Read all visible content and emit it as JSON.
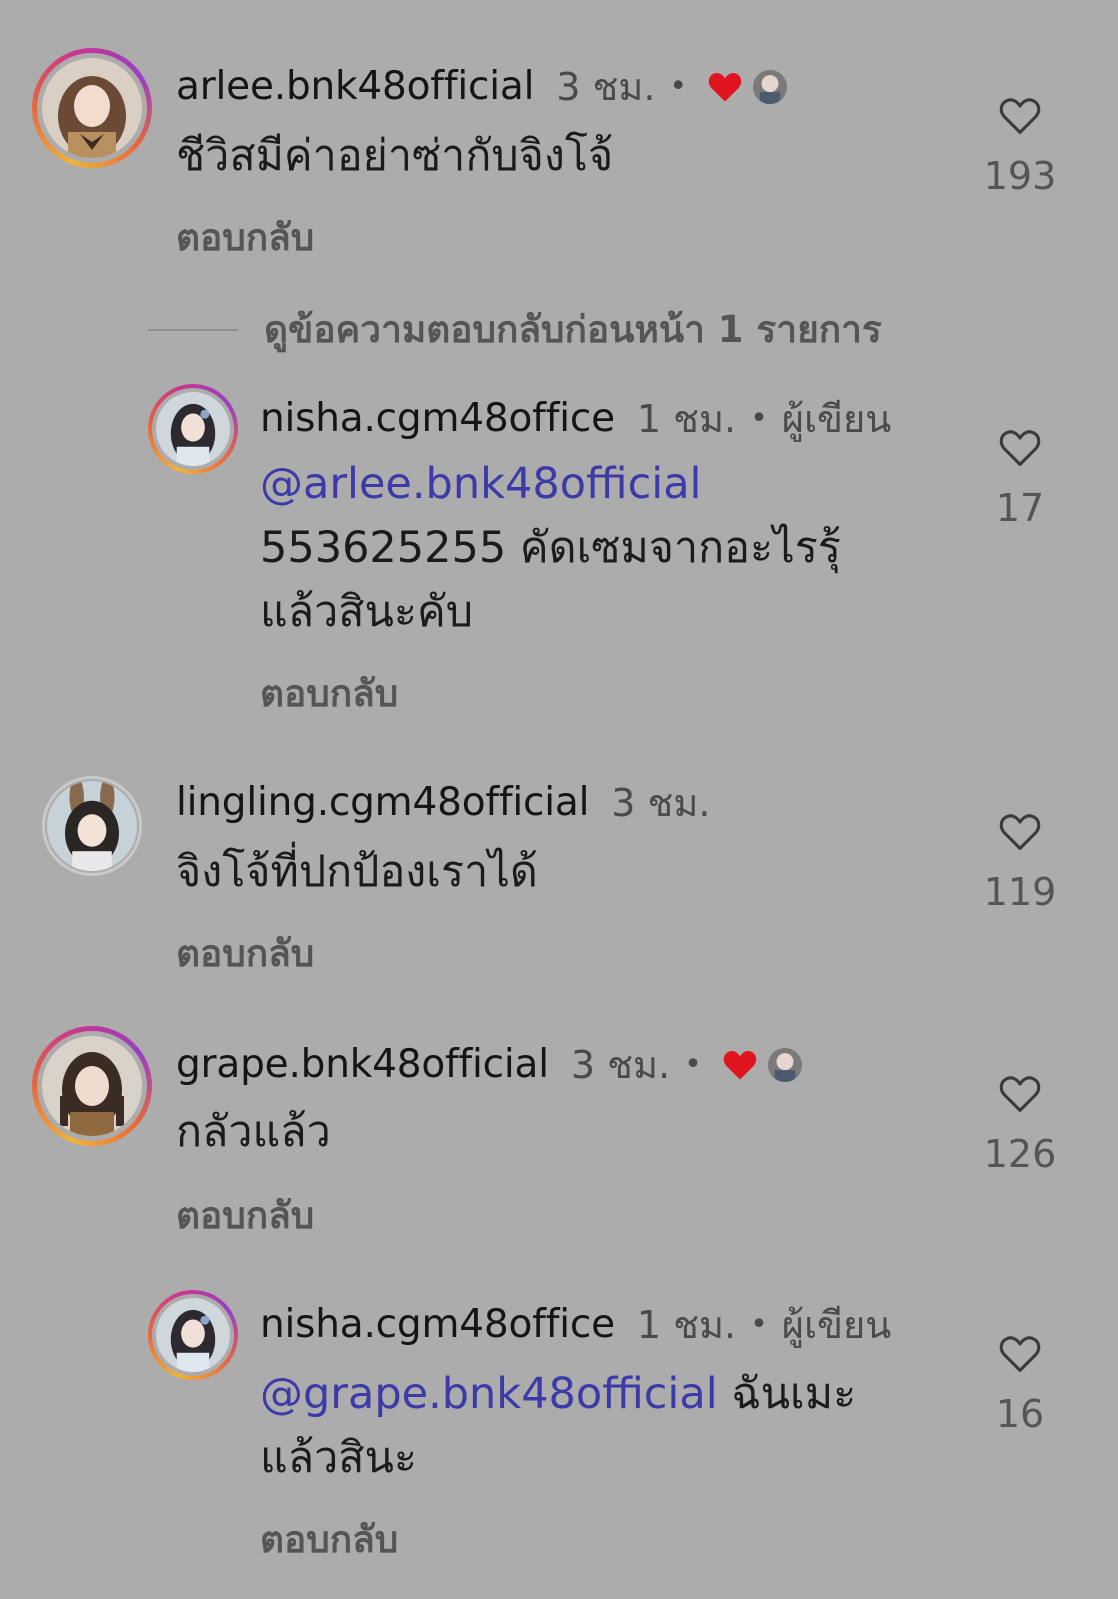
{
  "comments": [
    {
      "username": "arlee.bnk48official",
      "time": "3 ชม.",
      "text": "ชีวิสมีค่าอย่าซ่ากับจิงโจ้",
      "reply_label": "ตอบกลับ",
      "likes": "193",
      "liked_by_author": true
    },
    {
      "username": "nisha.cgm48office",
      "time": "1 ชม.",
      "author_label": "ผู้เขียน",
      "mention": "@arlee.bnk48official",
      "text_line1": "553625255 คัดเซมจากอะไรรุ้",
      "text_line2": "แล้วสินะคับ",
      "reply_label": "ตอบกลับ",
      "likes": "17"
    },
    {
      "username": "lingling.cgm48official",
      "time": "3 ชม.",
      "text": "จิงโจ้ที่ปกป้องเราได้",
      "reply_label": "ตอบกลับ",
      "likes": "119"
    },
    {
      "username": "grape.bnk48official",
      "time": "3 ชม.",
      "text": "กลัวแล้ว",
      "reply_label": "ตอบกลับ",
      "likes": "126",
      "liked_by_author": true
    },
    {
      "username": "nisha.cgm48office",
      "time": "1 ชม.",
      "author_label": "ผู้เขียน",
      "mention": "@grape.bnk48official",
      "text_after_mention": " ฉันเมะ",
      "text_line2": "แล้วสินะ",
      "reply_label": "ตอบกลับ",
      "likes": "16"
    }
  ],
  "view_previous": "ดูข้อความตอบกลับก่อนหน้า 1 รายการ",
  "separator": "•",
  "colors": {
    "background": "#acacac",
    "mention": "#3b3aa8",
    "heart": "#e0141f"
  }
}
